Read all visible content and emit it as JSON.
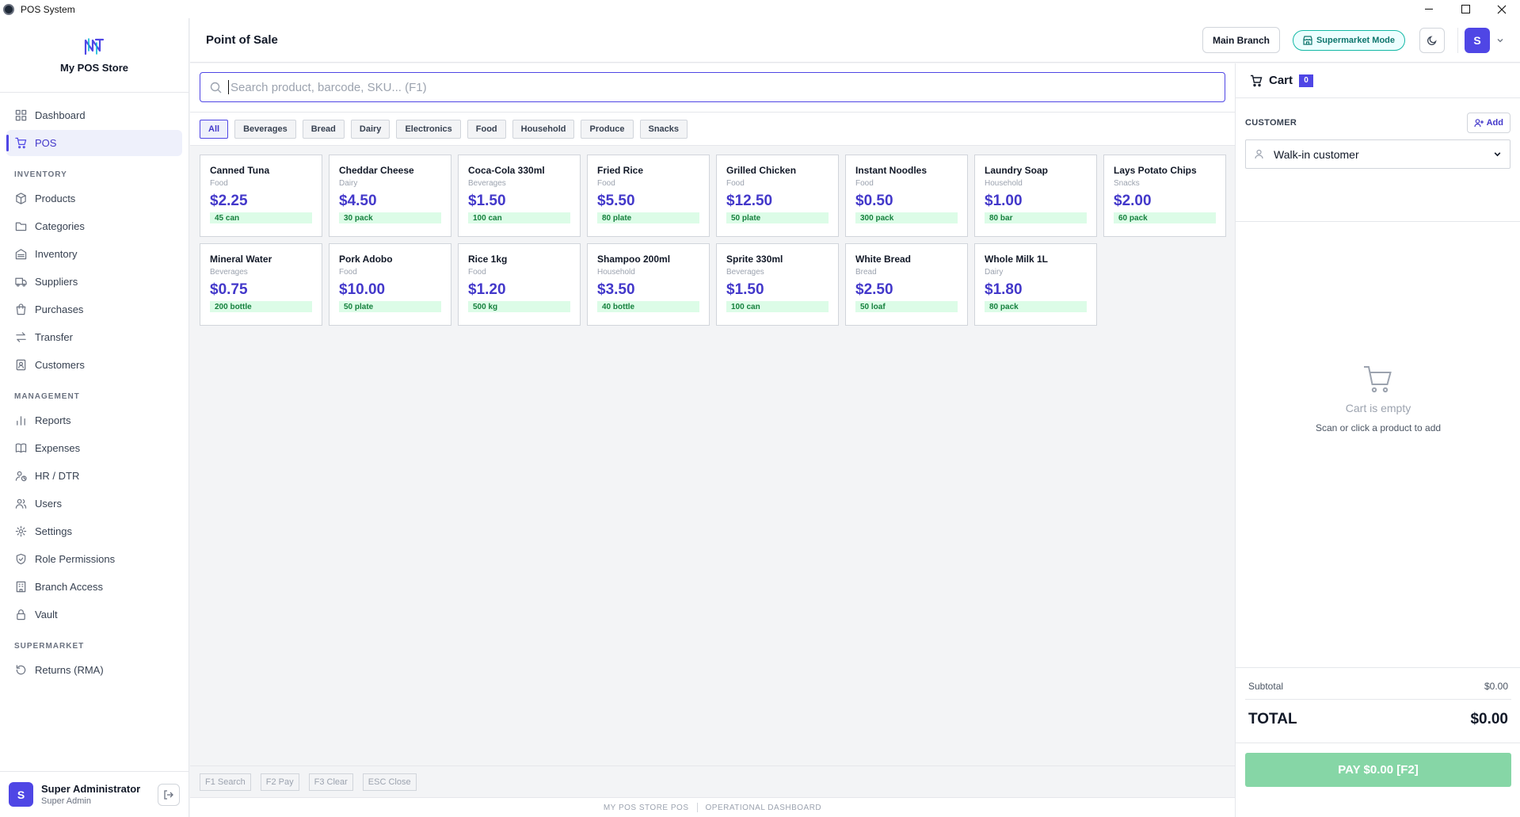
{
  "window": {
    "title": "POS System"
  },
  "brand": {
    "name": "My POS Store"
  },
  "sidebar": {
    "items": [
      {
        "label": "Dashboard",
        "icon": "grid-icon"
      },
      {
        "label": "POS",
        "icon": "cart-icon",
        "active": true
      }
    ],
    "sections": [
      {
        "title": "INVENTORY",
        "items": [
          {
            "label": "Products",
            "icon": "box-icon"
          },
          {
            "label": "Categories",
            "icon": "folder-icon"
          },
          {
            "label": "Inventory",
            "icon": "warehouse-icon"
          },
          {
            "label": "Suppliers",
            "icon": "truck-icon"
          },
          {
            "label": "Purchases",
            "icon": "bag-icon"
          },
          {
            "label": "Transfer",
            "icon": "transfer-icon"
          },
          {
            "label": "Customers",
            "icon": "contact-icon"
          }
        ]
      },
      {
        "title": "MANAGEMENT",
        "items": [
          {
            "label": "Reports",
            "icon": "bar-chart-icon"
          },
          {
            "label": "Expenses",
            "icon": "book-icon"
          },
          {
            "label": "HR / DTR",
            "icon": "user-clock-icon"
          },
          {
            "label": "Users",
            "icon": "users-icon"
          },
          {
            "label": "Settings",
            "icon": "gear-icon"
          },
          {
            "label": "Role Permissions",
            "icon": "shield-icon"
          },
          {
            "label": "Branch Access",
            "icon": "building-icon"
          },
          {
            "label": "Vault",
            "icon": "lock-icon"
          }
        ]
      },
      {
        "title": "SUPERMARKET",
        "items": [
          {
            "label": "Returns (RMA)",
            "icon": "rotate-icon"
          }
        ]
      }
    ]
  },
  "user": {
    "initial": "S",
    "name": "Super Administrator",
    "role": "Super Admin"
  },
  "header": {
    "title": "Point of Sale",
    "branch": "Main Branch",
    "mode": "Supermarket Mode",
    "profile_initial": "S"
  },
  "search": {
    "placeholder": "Search product, barcode, SKU... (F1)",
    "value": ""
  },
  "categories": [
    "All",
    "Beverages",
    "Bread",
    "Dairy",
    "Electronics",
    "Food",
    "Household",
    "Produce",
    "Snacks"
  ],
  "active_category": "All",
  "products": [
    {
      "name": "Canned Tuna",
      "category": "Food",
      "price": "$2.25",
      "stock": "45 can"
    },
    {
      "name": "Cheddar Cheese",
      "category": "Dairy",
      "price": "$4.50",
      "stock": "30 pack"
    },
    {
      "name": "Coca-Cola 330ml",
      "category": "Beverages",
      "price": "$1.50",
      "stock": "100 can"
    },
    {
      "name": "Fried Rice",
      "category": "Food",
      "price": "$5.50",
      "stock": "80 plate"
    },
    {
      "name": "Grilled Chicken",
      "category": "Food",
      "price": "$12.50",
      "stock": "50 plate"
    },
    {
      "name": "Instant Noodles",
      "category": "Food",
      "price": "$0.50",
      "stock": "300 pack"
    },
    {
      "name": "Laundry Soap",
      "category": "Household",
      "price": "$1.00",
      "stock": "80 bar"
    },
    {
      "name": "Lays Potato Chips",
      "category": "Snacks",
      "price": "$2.00",
      "stock": "60 pack"
    },
    {
      "name": "Mineral Water",
      "category": "Beverages",
      "price": "$0.75",
      "stock": "200 bottle"
    },
    {
      "name": "Pork Adobo",
      "category": "Food",
      "price": "$10.00",
      "stock": "50 plate"
    },
    {
      "name": "Rice 1kg",
      "category": "Food",
      "price": "$1.20",
      "stock": "500 kg"
    },
    {
      "name": "Shampoo 200ml",
      "category": "Household",
      "price": "$3.50",
      "stock": "40 bottle"
    },
    {
      "name": "Sprite 330ml",
      "category": "Beverages",
      "price": "$1.50",
      "stock": "100 can"
    },
    {
      "name": "White Bread",
      "category": "Bread",
      "price": "$2.50",
      "stock": "50 loaf"
    },
    {
      "name": "Whole Milk 1L",
      "category": "Dairy",
      "price": "$1.80",
      "stock": "80 pack"
    }
  ],
  "shortcuts": [
    "F1 Search",
    "F2 Pay",
    "F3 Clear",
    "ESC Close"
  ],
  "footer": {
    "left": "MY POS STORE POS",
    "right": "OPERATIONAL DASHBOARD"
  },
  "cart": {
    "title": "Cart",
    "count": "0",
    "customer_label": "CUSTOMER",
    "add_label": "Add",
    "customer_value": "Walk-in customer",
    "empty_title": "Cart is empty",
    "empty_sub": "Scan or click a product to add",
    "subtotal_label": "Subtotal",
    "subtotal_value": "$0.00",
    "total_label": "TOTAL",
    "total_value": "$0.00",
    "pay_label": "PAY $0.00 [F2]"
  },
  "colors": {
    "accent": "#4f46e5",
    "stock_bg": "#dcfce7",
    "stock_text": "#15803d",
    "pay_disabled": "#86d6a6",
    "mode_teal": "#0f766e"
  }
}
